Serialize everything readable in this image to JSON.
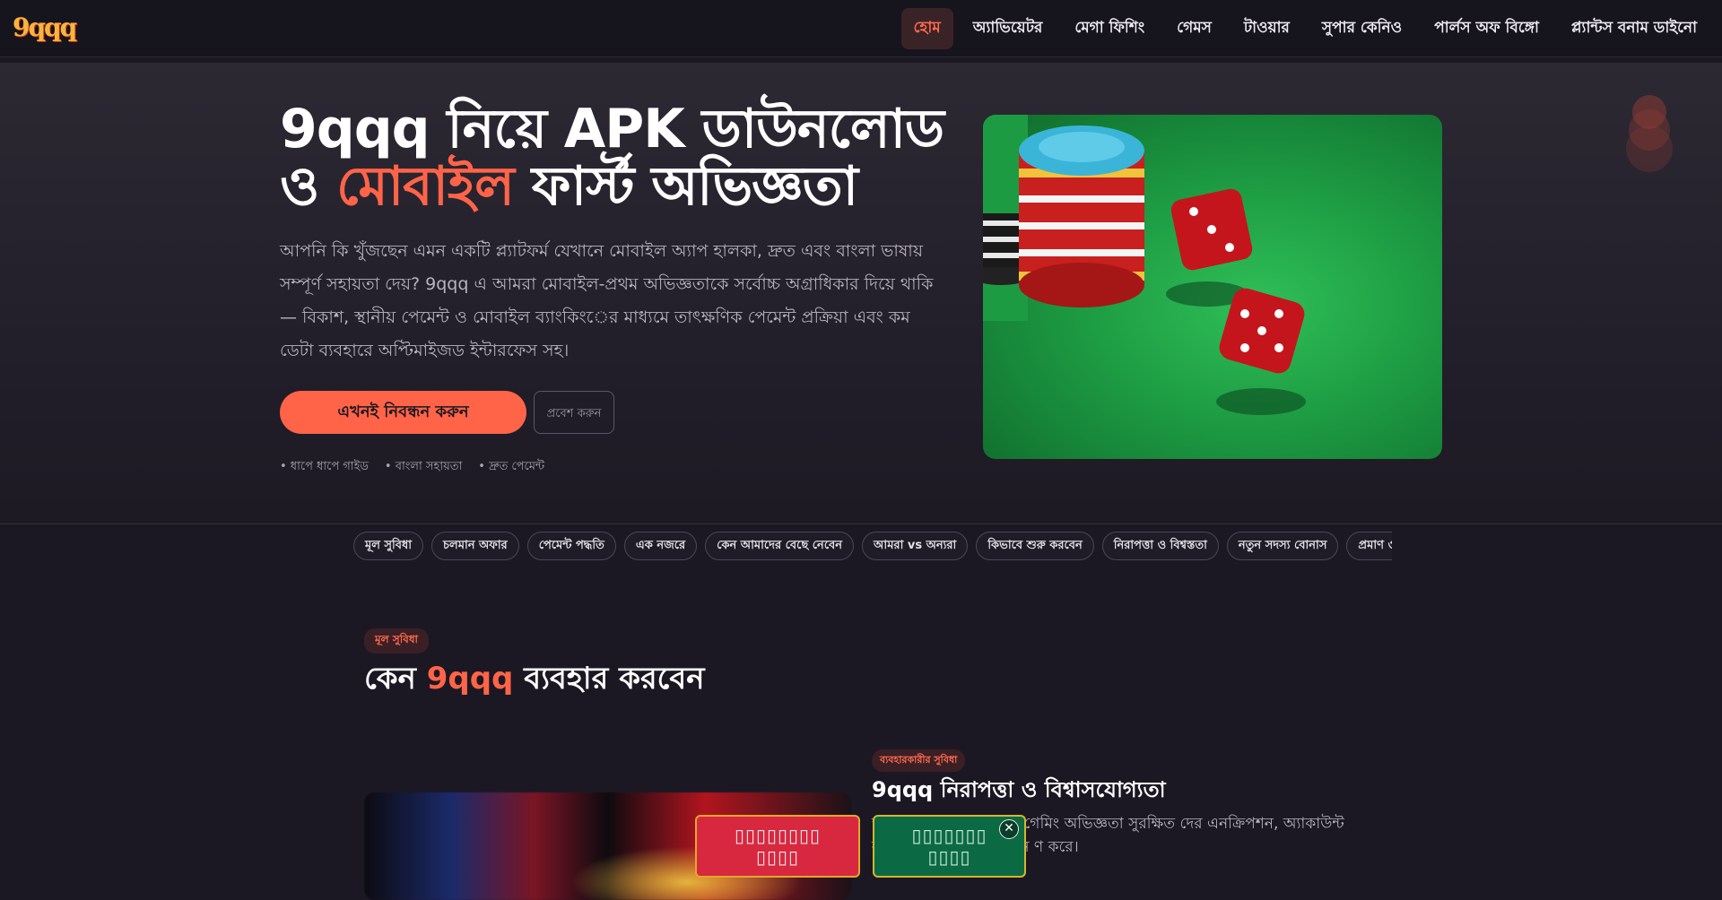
{
  "nav": {
    "logo": "9qqq",
    "items": [
      {
        "label": "হোম",
        "active": true
      },
      {
        "label": "অ্যাভিয়েটর",
        "active": false
      },
      {
        "label": "মেগা ফিশিং",
        "active": false
      },
      {
        "label": "গেমস",
        "active": false
      },
      {
        "label": "টাওয়ার",
        "active": false
      },
      {
        "label": "সুপার কেনিও",
        "active": false
      },
      {
        "label": "পার্লস অফ বিঙ্গো",
        "active": false
      },
      {
        "label": "প্ল্যান্টস বনাম ডাইনো",
        "active": false
      }
    ]
  },
  "hero": {
    "title_part1": "9qqq নিয়ে APK ডাউনলোড ও ",
    "title_accent": "মোবাইল",
    "title_part2": " ফার্স্ট অভিজ্ঞতা",
    "description": "আপনি কি খুঁজছেন এমন একটি প্ল্যাটফর্ম যেখানে মোবাইল অ্যাপ হালকা, দ্রুত এবং বাংলা ভাষায় সম্পূর্ণ সহায়তা দেয়? 9qqq এ আমরা মোবাইল-প্রথম অভিজ্ঞতাকে সর্বোচ্চ অগ্রাধিকার দিয়ে থাকি — বিকাশ, স্থানীয় পেমেন্ট ও মোবাইল ব্যাংকিংের মাধ্যমে তাৎক্ষণিক পেমেন্ট প্রক্রিয়া এবং কম ডেটা ব্যবহারে অপ্টিমাইজড ইন্টারফেস সহ।",
    "primary_button": "এখনই নিবন্ধন করুন",
    "secondary_button": "প্রবেশ করুন",
    "bullets": [
      "• ধাপে ধাপে গাইড",
      "• বাংলা সহায়তা",
      "• দ্রুত পেমেন্ট"
    ],
    "image_icon": "casino-dice-chips-image"
  },
  "chips": [
    "মূল সুবিধা",
    "চলমান অফার",
    "পেমেন্ট পদ্ধতি",
    "এক নজরে",
    "কেন আমাদের বেছে নেবেন",
    "আমরা vs অন্যরা",
    "কিভাবে শুরু করবেন",
    "নিরাপত্তা ও বিশ্বস্ততা",
    "নতুন সদস্য বোনাস",
    "প্রমাণ ও"
  ],
  "section": {
    "badge": "মূল সুবিধা",
    "title_part1": "কেন ",
    "title_accent": "9qqq",
    "title_part2": " ব্যবহার করবেন",
    "sub_badge": "ব্যবহারকারীর সুবিধা",
    "sub_title": "9qqq নিরাপত্তা ও বিশ্বাসযোগ্যতা",
    "sub_desc": "অ্যাপের মাধ্যমে আপনার গেমিং অভিজ্ঞতা সুরক্ষিত দের এনক্রিপশন, অ্যাকাউন্ট সুরক্ষা এবং জমা-উত্তোলন ণ করে।"
  },
  "fab": {
    "red_label": "▯▯▯▯▯▯▯▯ ▯▯▯▯",
    "green_label": "▯▯▯▯▯▯▯ ▯▯▯▯",
    "close": "✕"
  },
  "colors": {
    "accent": "#ff6448",
    "background": "#1b1824",
    "fab_red": "#d8283f",
    "fab_green": "#0b6a43"
  }
}
